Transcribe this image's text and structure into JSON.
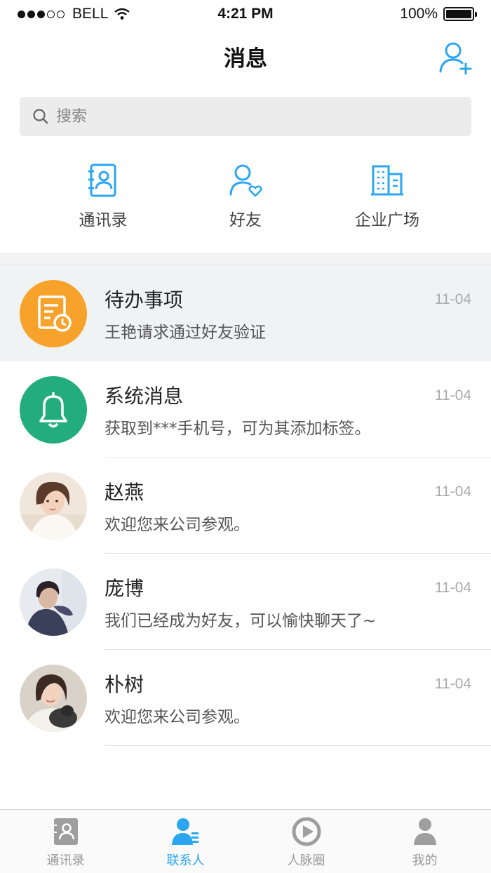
{
  "status_bar": {
    "carrier": "BELL",
    "time": "4:21 PM",
    "battery": "100%",
    "battery_level": 1.0,
    "signal_bars": 3
  },
  "header": {
    "title": "消息",
    "add_friend_icon": "add-user-icon"
  },
  "search": {
    "placeholder": "搜索"
  },
  "shortcuts": [
    {
      "label": "通讯录",
      "icon": "address-book-icon"
    },
    {
      "label": "好友",
      "icon": "friend-icon"
    },
    {
      "label": "企业广场",
      "icon": "building-icon"
    }
  ],
  "conversations": [
    {
      "title": "待办事项",
      "subtitle": "王艳请求通过好友验证",
      "time": "11-04",
      "avatar": "todo-icon",
      "avatar_color": "#f7a22b"
    },
    {
      "title": "系统消息",
      "subtitle": "获取到***手机号，可为其添加标签。",
      "time": "11-04",
      "avatar": "bell-icon",
      "avatar_color": "#23ad7f"
    },
    {
      "title": "赵燕",
      "subtitle": "欢迎您来公司参观。",
      "time": "11-04",
      "avatar": "user-avatar"
    },
    {
      "title": "庞博",
      "subtitle": "我们已经成为好友，可以愉快聊天了~",
      "time": "11-04",
      "avatar": "user-avatar"
    },
    {
      "title": "朴树",
      "subtitle": "欢迎您来公司参观。",
      "time": "11-04",
      "avatar": "user-avatar"
    }
  ],
  "tabs": [
    {
      "label": "通讯录",
      "icon": "contacts-book-icon",
      "active": false
    },
    {
      "label": "联系人",
      "icon": "person-list-icon",
      "active": true
    },
    {
      "label": "人脉圈",
      "icon": "circle-play-icon",
      "active": false
    },
    {
      "label": "我的",
      "icon": "profile-icon",
      "active": false
    }
  ],
  "colors": {
    "accent": "#2ba6f0",
    "todo": "#f7a22b",
    "system": "#23ad7f",
    "highlight_row": "#f0f3f4"
  }
}
